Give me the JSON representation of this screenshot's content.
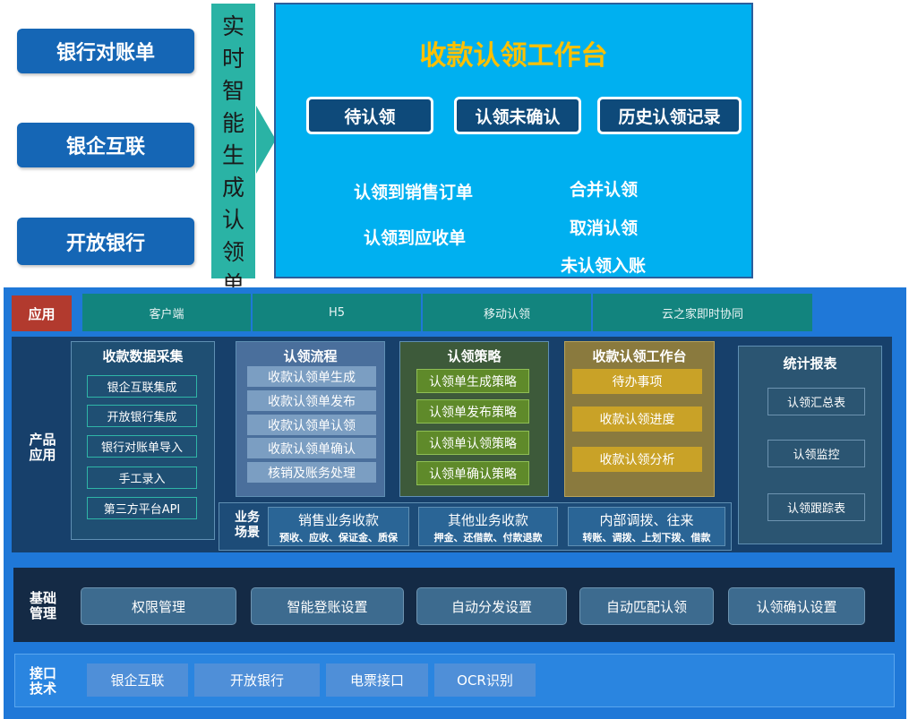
{
  "sources": [
    "银行对账单",
    "银企互联",
    "开放银行"
  ],
  "vertical_label": [
    "实",
    "时",
    "智",
    "能",
    "生",
    "成",
    "认",
    "领",
    "单"
  ],
  "workbench": {
    "title": "收款认领工作台",
    "buttons": [
      "待认领",
      "认领未确认",
      "历史认领记录"
    ],
    "actions": [
      "认领到销售订单",
      "合并认领",
      "认领到应收单",
      "取消认领",
      "未认领入账"
    ]
  },
  "app_layer": {
    "label": "应用",
    "tabs": [
      "客户端",
      "H5",
      "移动认领",
      "云之家即时协同"
    ]
  },
  "product_layer": {
    "label": "产品\n应用",
    "collection": {
      "title": "收款数据采集",
      "items": [
        "银企互联集成",
        "开放银行集成",
        "银行对账单导入",
        "手工录入",
        "第三方平台API"
      ]
    },
    "flow": {
      "title": "认领流程",
      "items": [
        "收款认领单生成",
        "收款认领单发布",
        "收款认领单认领",
        "收款认领单确认",
        "核销及账务处理"
      ]
    },
    "strategy": {
      "title": "认领策略",
      "items": [
        "认领单生成策略",
        "认领单发布策略",
        "认领单认领策略",
        "认领单确认策略"
      ]
    },
    "workbench": {
      "title": "收款认领工作台",
      "items": [
        "待办事项",
        "收款认领进度",
        "收款认领分析"
      ]
    },
    "reports": {
      "title": "统计报表",
      "items": [
        "认领汇总表",
        "认领监控",
        "认领跟踪表"
      ]
    },
    "scenes": {
      "label": "业务\n场景",
      "items": [
        {
          "name": "销售业务收款",
          "detail": "预收、应收、保证金、质保"
        },
        {
          "name": "其他业务收款",
          "detail": "押金、还借款、付款退款"
        },
        {
          "name": "内部调拨、往来",
          "detail": "转账、调拨、上划下拨、借款"
        }
      ]
    }
  },
  "base_layer": {
    "label": "基础\n管理",
    "items": [
      "权限管理",
      "智能登账设置",
      "自动分发设置",
      "自动匹配认领",
      "认领确认设置"
    ]
  },
  "interface_layer": {
    "label": "接口\n技术",
    "items": [
      "银企互联",
      "开放银行",
      "电票接口",
      "OCR识别"
    ]
  },
  "colors": {
    "primary_blue": "#1566b5",
    "teal": "#2ab3a5",
    "sky": "#00b0f0",
    "title_gold": "#ffc000",
    "strategy_green": "#5f8a2a",
    "workbench_gold": "#c9a227"
  }
}
